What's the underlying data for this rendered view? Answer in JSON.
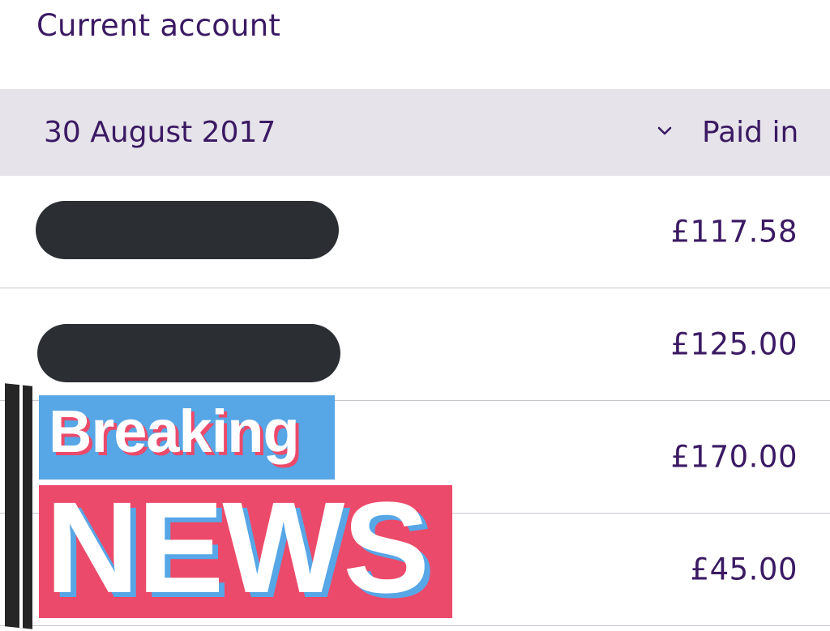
{
  "header": {
    "title": "Current account"
  },
  "date_group": {
    "date": "30 August 2017",
    "column_label": "Paid in",
    "sort_icon": "chevron-down-icon"
  },
  "transactions": [
    {
      "description": "",
      "amount": "£117.58",
      "redacted": true
    },
    {
      "description": "",
      "amount": "£125.00",
      "redacted": true
    },
    {
      "description": "",
      "amount": "£170.00",
      "redacted": false
    },
    {
      "description": "",
      "amount": "£45.00",
      "redacted": false
    }
  ],
  "overlay": {
    "line1": "Breaking",
    "line2": "NEWS"
  },
  "colors": {
    "brand_purple": "#3b1a63",
    "band_grey": "#e6e3ea",
    "redaction": "#2b2f33",
    "overlay_blue": "#57a6e6",
    "overlay_pink": "#ec4a6a"
  }
}
